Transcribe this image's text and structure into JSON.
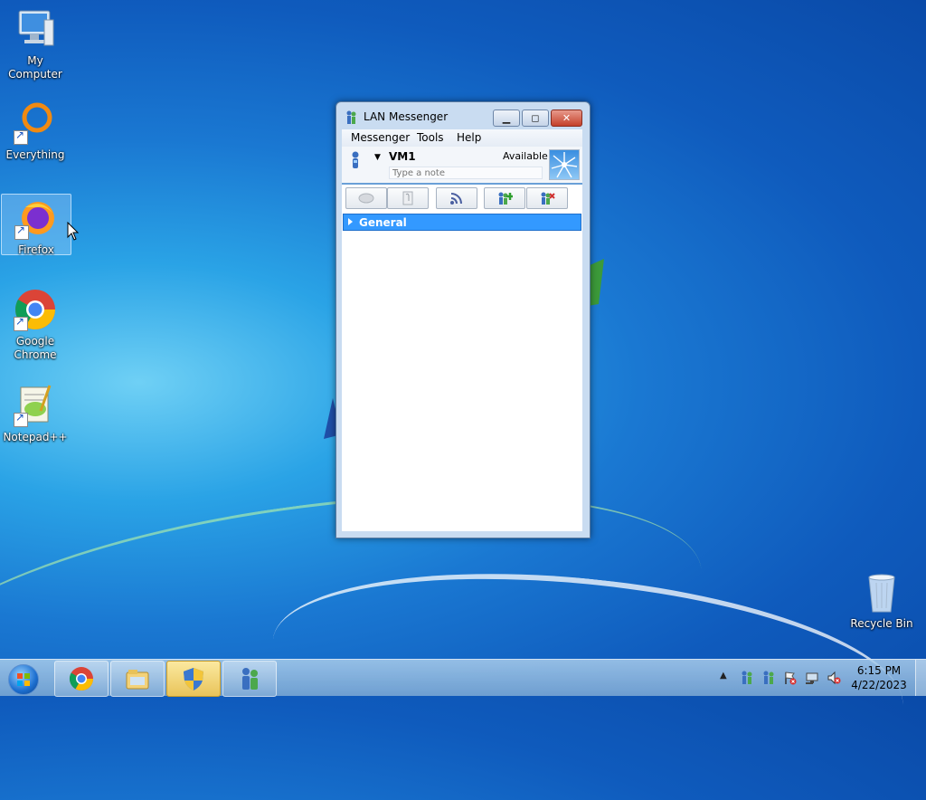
{
  "desktop": {
    "icons": [
      {
        "label": "My Computer",
        "icon": "computer-icon"
      },
      {
        "label": "Everything",
        "icon": "everything-search-icon"
      },
      {
        "label": "Firefox",
        "icon": "firefox-icon",
        "selected": true
      },
      {
        "label": "Google Chrome",
        "icon": "chrome-icon"
      },
      {
        "label": "Notepad++",
        "icon": "notepadpp-icon"
      },
      {
        "label": "Recycle Bin",
        "icon": "recycle-bin-icon"
      }
    ]
  },
  "window": {
    "title": "LAN Messenger",
    "menu": [
      "Messenger",
      "Tools",
      "Help"
    ],
    "user": {
      "name": "VM1",
      "status": "Available",
      "note_placeholder": "Type a note"
    },
    "toolbar": [
      "chat-icon",
      "file-transfer-icon",
      "broadcast-icon",
      "add-contact-icon",
      "remove-contact-icon"
    ],
    "groups": [
      {
        "label": "General",
        "expanded": false
      }
    ]
  },
  "taskbar": {
    "buttons": [
      "chrome-icon",
      "file-explorer-icon",
      "security-shield-icon",
      "lan-messenger-icon"
    ],
    "active": "security-shield-icon",
    "clock": {
      "time": "6:15 PM",
      "date": "4/22/2023"
    }
  },
  "colors": {
    "accent": "#3399ff",
    "desktop": "#1a78d2"
  }
}
